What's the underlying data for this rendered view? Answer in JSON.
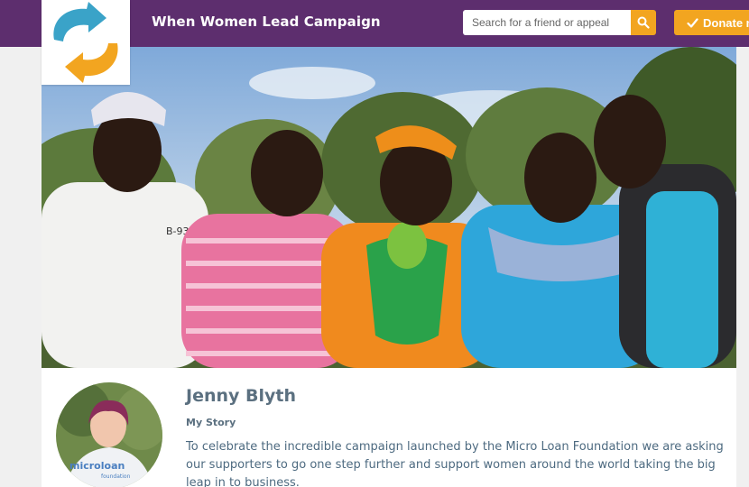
{
  "header": {
    "campaign_title": "When Women Lead Campaign",
    "search_placeholder": "Search for a friend or appeal",
    "donate_label": "Donate n"
  },
  "profile": {
    "name": "Jenny Blyth",
    "story_label": "My Story",
    "story_text": "To celebrate the incredible campaign launched by the Micro Loan Foundation we are asking our supporters to go one step further and support women around the world taking the big leap in to business.",
    "avatar_shirt_text": "microloan",
    "avatar_shirt_subtext": "foundation"
  },
  "hero": {
    "shirt_text": "B-93"
  },
  "colors": {
    "header_bg": "#5d2e6e",
    "accent": "#f2a520",
    "logo_blue": "#3aa3c8",
    "logo_orange": "#f2a520",
    "name_color": "#5b7080"
  },
  "icons": {
    "search": "search-icon",
    "donate": "check-icon",
    "logo": "swap-arrows-logo"
  }
}
